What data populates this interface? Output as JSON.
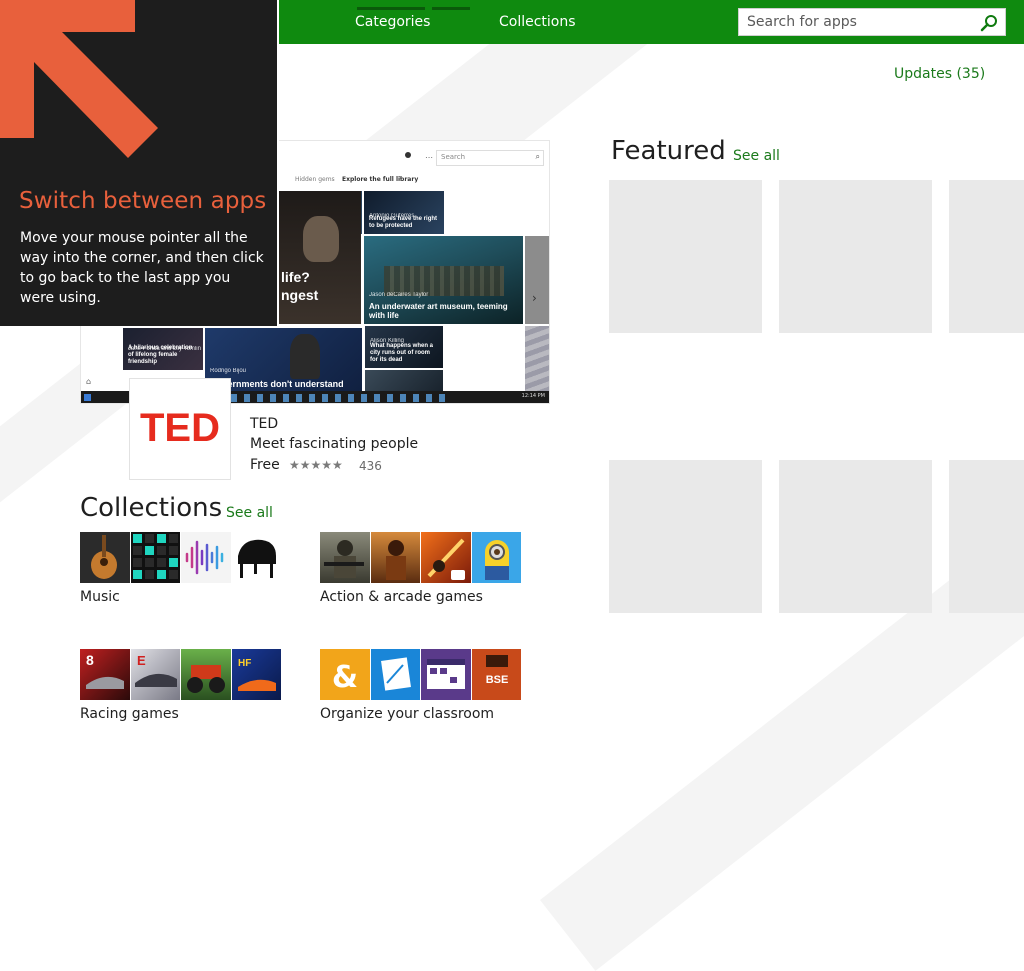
{
  "colors": {
    "accent": "#0f8a0f",
    "link": "#1b7a1b",
    "charm_bg": "#1d1d1d",
    "charm_title": "#e8603c",
    "placeholder_tile": "#e9e9e9"
  },
  "nav": {
    "tabs": [
      {
        "label": "Categories"
      },
      {
        "label": "Collections"
      }
    ]
  },
  "search": {
    "placeholder": "Search for apps",
    "icon": "search-icon"
  },
  "updates": {
    "label": "Updates (35)"
  },
  "charm": {
    "icon": "arrow-up-left-icon",
    "title": "Switch between apps",
    "body": "Move your mouse pointer all the way into the corner, and then click to go back to the last app you were using."
  },
  "hero": {
    "screenshot": {
      "search_placeholder": "Search",
      "tabs": [
        "Hidden gems",
        "Explore the full library"
      ],
      "tiles": [
        {
          "author": "Antonio Guterres",
          "caption": "Refugees have the right to be protected"
        },
        {
          "author": "Jason deCaires Taylor",
          "caption": "An underwater art museum, teeming with life"
        },
        {
          "caption_a": "life?",
          "caption_b": "ngest"
        },
        {
          "author": "Jane Fonda and Lily Tomlin",
          "caption": "A hilarious celebration of lifelong female friendship"
        },
        {
          "author": "Rodrigo Bijou",
          "caption": "Governments don't understand"
        },
        {
          "author": "Alison Killing",
          "caption": "What happens when a city runs out of room for its dead"
        }
      ],
      "clock": "12:14 PM"
    },
    "app": {
      "logo_text": "TED",
      "name": "TED",
      "tagline": "Meet fascinating people",
      "price": "Free",
      "rating_stars": "★★★★★",
      "rating_count": "436"
    }
  },
  "collections": {
    "title": "Collections",
    "see_all": "See all",
    "items": [
      {
        "label": "Music",
        "thumbs": [
          "guitar",
          "drum-pads",
          "audio-wave",
          "piano"
        ]
      },
      {
        "label": "Action & arcade games",
        "thumbs": [
          "soldier",
          "warrior",
          "knight",
          "minion"
        ]
      },
      {
        "label": "Racing games",
        "thumbs": [
          "asphalt-8",
          "car-silver",
          "monster-truck",
          "high-fuel"
        ]
      },
      {
        "label": "Organize your classroom",
        "thumbs": [
          "ampersand-app",
          "whiteboard-app",
          "calendar-app",
          "bse-app"
        ]
      }
    ]
  },
  "featured": {
    "title": "Featured",
    "see_all": "See all",
    "tile_count": 6
  }
}
